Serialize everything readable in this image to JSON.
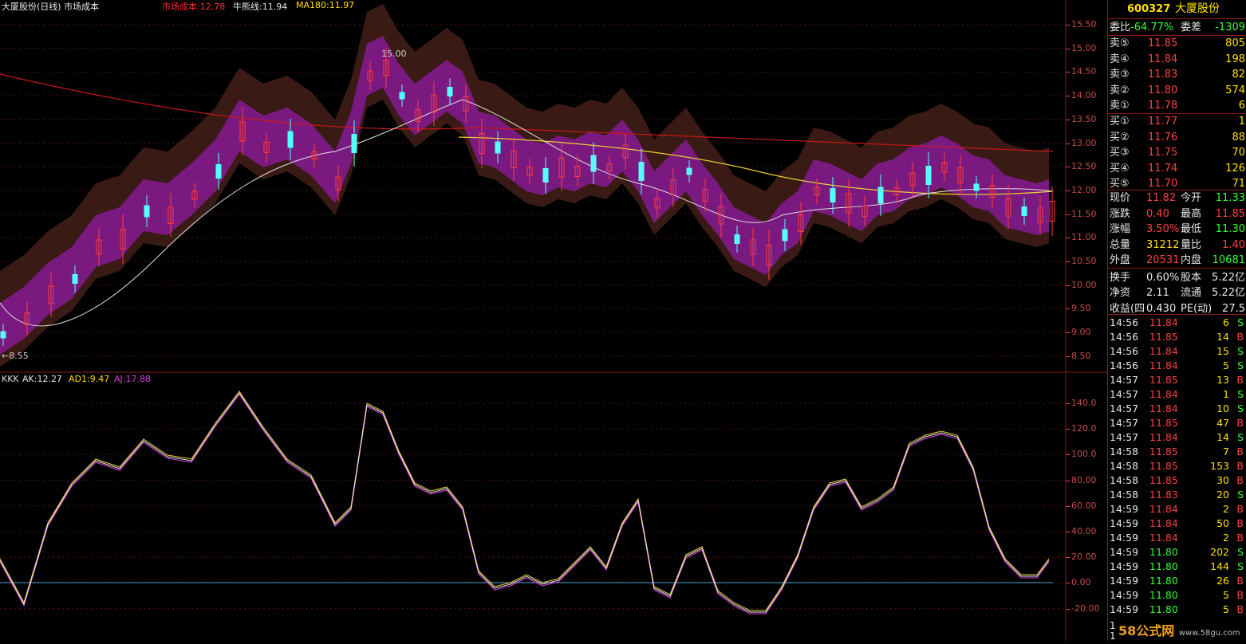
{
  "top_bar": {
    "title": "大厦股份(日线) 市场成本",
    "cost_label": "市场成本:12.78",
    "bull_label": "牛熊线:11.94",
    "ma_label": "MA180:11.97"
  },
  "main_chart": {
    "high_mark": "15.00",
    "low_mark": "←8.55",
    "price_axis": [
      "15.50",
      "15.00",
      "14.50",
      "14.00",
      "13.50",
      "13.00",
      "12.50",
      "12.00",
      "11.50",
      "11.00",
      "10.50",
      "10.00",
      "9.50",
      "9.00",
      "8.50"
    ]
  },
  "sub_chart": {
    "label_kkk": "KKK",
    "label_ak": "AK:12.27",
    "label_ad": "AD1:9.47",
    "label_aj": "AJ:17.88",
    "axis": [
      "140.0",
      "120.0",
      "100.0",
      "80.00",
      "60.00",
      "40.00",
      "20.00",
      "0.00",
      "-20.00"
    ]
  },
  "colors": {
    "up": "#ff3c3c",
    "down": "#54ffff",
    "band": "#7a1a80",
    "outer_band": "#3a1a14",
    "ma180": "#c81818",
    "bull": "#e8d030",
    "white_line": "#e0e0e0",
    "panel_border": "#8a1b1b"
  },
  "quote": {
    "code": "600327",
    "name": "大厦股份",
    "wei_bi_label": "委比",
    "wei_bi": "-64.77%",
    "wei_cha_label": "委差",
    "wei_cha": "-1309",
    "sells": [
      {
        "label": "卖⑤",
        "price": "11.85",
        "vol": "805"
      },
      {
        "label": "卖④",
        "price": "11.84",
        "vol": "198"
      },
      {
        "label": "卖③",
        "price": "11.83",
        "vol": "82"
      },
      {
        "label": "卖②",
        "price": "11.80",
        "vol": "574"
      },
      {
        "label": "卖①",
        "price": "11.78",
        "vol": "6"
      }
    ],
    "buys": [
      {
        "label": "买①",
        "price": "11.77",
        "vol": "1"
      },
      {
        "label": "买②",
        "price": "11.76",
        "vol": "88"
      },
      {
        "label": "买③",
        "price": "11.75",
        "vol": "70"
      },
      {
        "label": "买④",
        "price": "11.74",
        "vol": "126"
      },
      {
        "label": "买⑤",
        "price": "11.70",
        "vol": "71"
      }
    ],
    "stats": [
      {
        "l1": "现价",
        "v1": "11.82",
        "c1": "red",
        "l2": "今开",
        "v2": "11.33",
        "c2": "green"
      },
      {
        "l1": "涨跌",
        "v1": "0.40",
        "c1": "red",
        "l2": "最高",
        "v2": "11.85",
        "c2": "red"
      },
      {
        "l1": "涨幅",
        "v1": "3.50%",
        "c1": "red",
        "l2": "最低",
        "v2": "11.30",
        "c2": "green"
      },
      {
        "l1": "总量",
        "v1": "31212",
        "c1": "yellow",
        "l2": "量比",
        "v2": "1.40",
        "c2": "red"
      },
      {
        "l1": "外盘",
        "v1": "20531",
        "c1": "red",
        "l2": "内盘",
        "v2": "10681",
        "c2": "green"
      },
      {
        "l1": "换手",
        "v1": "0.60%",
        "c1": "white",
        "l2": "股本",
        "v2": "5.22亿",
        "c2": "white"
      },
      {
        "l1": "净资",
        "v1": "2.11",
        "c1": "white",
        "l2": "流通",
        "v2": "5.22亿",
        "c2": "white"
      },
      {
        "l1": "收益(四",
        "v1": "0.430",
        "c1": "white",
        "l2": "PE(动)",
        "v2": "27.5",
        "c2": "white"
      }
    ],
    "ticks": [
      {
        "t": "14:56",
        "p": "11.84",
        "v": "6",
        "s": "S"
      },
      {
        "t": "14:56",
        "p": "11.85",
        "v": "14",
        "s": "B"
      },
      {
        "t": "14:56",
        "p": "11.84",
        "v": "15",
        "s": "S"
      },
      {
        "t": "14:56",
        "p": "11.84",
        "v": "5",
        "s": "S"
      },
      {
        "t": "14:57",
        "p": "11.85",
        "v": "13",
        "s": "B"
      },
      {
        "t": "14:57",
        "p": "11.84",
        "v": "1",
        "s": "S"
      },
      {
        "t": "14:57",
        "p": "11.84",
        "v": "10",
        "s": "S"
      },
      {
        "t": "14:57",
        "p": "11.85",
        "v": "47",
        "s": "B"
      },
      {
        "t": "14:57",
        "p": "11.84",
        "v": "14",
        "s": "S"
      },
      {
        "t": "14:58",
        "p": "11.85",
        "v": "7",
        "s": "B"
      },
      {
        "t": "14:58",
        "p": "11.85",
        "v": "153",
        "s": "B"
      },
      {
        "t": "14:58",
        "p": "11.85",
        "v": "30",
        "s": "B"
      },
      {
        "t": "14:58",
        "p": "11.83",
        "v": "20",
        "s": "S"
      },
      {
        "t": "14:59",
        "p": "11.84",
        "v": "2",
        "s": "B"
      },
      {
        "t": "14:59",
        "p": "11.84",
        "v": "50",
        "s": "B"
      },
      {
        "t": "14:59",
        "p": "11.84",
        "v": "2",
        "s": "B"
      },
      {
        "t": "14:59",
        "p": "11.80",
        "v": "202",
        "s": "S"
      },
      {
        "t": "14:59",
        "p": "11.80",
        "v": "144",
        "s": "S"
      },
      {
        "t": "14:59",
        "p": "11.80",
        "v": "26",
        "s": "B"
      },
      {
        "t": "14:59",
        "p": "11.80",
        "v": "5",
        "s": "B"
      },
      {
        "t": "14:59",
        "p": "11.80",
        "v": "5",
        "s": "B"
      }
    ],
    "tail": [
      "1",
      "1"
    ]
  },
  "watermark": {
    "brand": "58公式网",
    "url": "www.58gu.com"
  }
}
